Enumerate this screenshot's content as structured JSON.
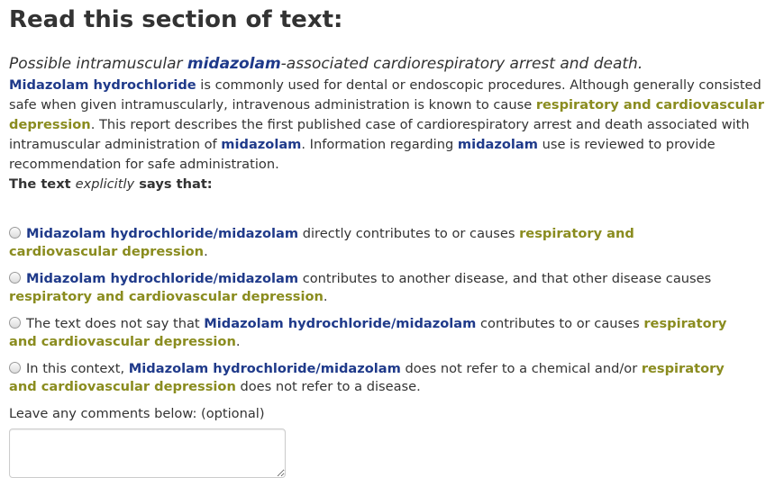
{
  "heading": "Read this section of text:",
  "title": {
    "before": "Possible intramuscular ",
    "chemical": "midazolam",
    "after": "-associated cardiorespiratory arrest and death."
  },
  "abstract": {
    "chem1": "Midazolam hydrochloride",
    "t1": " is commonly used for dental or endoscopic procedures. Although generally consisted safe when given intramuscularly, intravenous administration is known to cause ",
    "disease1": "respiratory and cardiovascular depression",
    "t2": ". This report describes the first published case of cardiorespiratory arrest and death associated with intramuscular administration of ",
    "chem2": "midazolam",
    "t3": ". Information regarding ",
    "chem3": "midazolam",
    "t4": " use is reviewed to provide recommendation for safe administration."
  },
  "prompt": {
    "before": "The text ",
    "emph": "explicitly",
    "after": " says that:"
  },
  "options": [
    {
      "chemical": "Midazolam hydrochloride/midazolam",
      "middle": " directly contributes to or causes ",
      "disease": "respiratory and cardiovascular depression",
      "end": "."
    },
    {
      "chemical": "Midazolam hydrochloride/midazolam",
      "middle": " contributes to another disease, and that other disease causes ",
      "disease": "respiratory and cardiovascular depression",
      "end": "."
    },
    {
      "prefix": "The text does not say that ",
      "chemical": "Midazolam hydrochloride/midazolam",
      "middle": " contributes to or causes ",
      "disease": "respiratory and cardiovascular depression",
      "end": "."
    },
    {
      "prefix": "In this context, ",
      "chemical": "Midazolam hydrochloride/midazolam",
      "middle": " does not refer to a chemical and/or ",
      "disease": "respiratory and cardiovascular depression",
      "end": " does not refer to a disease."
    }
  ],
  "comments": {
    "label": "Leave any comments below: (optional)",
    "value": ""
  },
  "colors": {
    "chemical": "#1f3a8a",
    "disease": "#8a8c1f"
  }
}
